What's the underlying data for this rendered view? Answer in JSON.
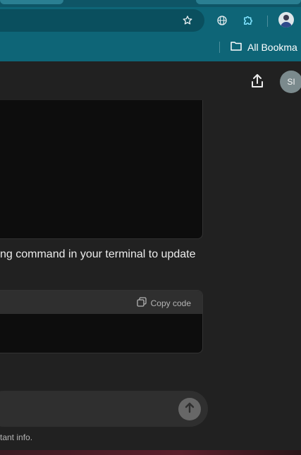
{
  "browser": {
    "icons": {
      "bookmark_star": "star-icon",
      "site_settings": "globe-icon",
      "extensions": "puzzle-icon",
      "profile": "avatar"
    },
    "bookmarks_bar": {
      "folder_label": "All Bookma"
    }
  },
  "chat": {
    "user_initials": "SI",
    "message_fragment": "ng command in your terminal to update",
    "code_block": {
      "copy_label": "Copy code"
    },
    "composer": {
      "send_icon": "arrow-up-icon"
    },
    "disclaimer": "tant info."
  },
  "colors": {
    "chrome_teal": "#0e6577",
    "page_bg": "#212121",
    "code_bg": "#0d0d0d",
    "composer_bg": "#2f2f2f"
  }
}
